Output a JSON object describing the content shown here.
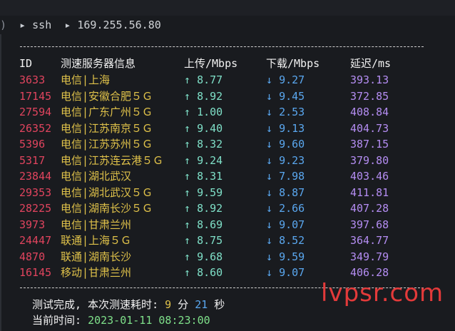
{
  "prompt": {
    "paren": ")",
    "arrow1": "▸",
    "command": "ssh",
    "arrow2": "▸",
    "host": "169.255.56.80"
  },
  "header": {
    "id": "ID",
    "name": "测速服务器信息",
    "upload": "上传/Mbps",
    "download": "下载/Mbps",
    "latency": "延迟/ms"
  },
  "up_arrow": "↑",
  "down_arrow": "↓",
  "rows": [
    {
      "id": "3633",
      "name": "电信|上海",
      "up": "8.77",
      "down": "9.27",
      "latency": "393.13"
    },
    {
      "id": "17145",
      "name": "电信|安徽合肥５Ｇ",
      "up": "8.92",
      "down": "9.45",
      "latency": "372.85"
    },
    {
      "id": "27594",
      "name": "电信|广东广州５Ｇ",
      "up": "1.00",
      "down": "2.53",
      "latency": "408.84"
    },
    {
      "id": "26352",
      "name": "电信|江苏南京５Ｇ",
      "up": "9.40",
      "down": "9.13",
      "latency": "404.73"
    },
    {
      "id": "5396",
      "name": "电信|江苏苏州５Ｇ",
      "up": "8.32",
      "down": "9.60",
      "latency": "387.15"
    },
    {
      "id": "5317",
      "name": "电信|江苏连云港５Ｇ",
      "up": "9.24",
      "down": "9.23",
      "latency": "379.80"
    },
    {
      "id": "23844",
      "name": "电信|湖北武汉",
      "up": "8.31",
      "down": "7.98",
      "latency": "403.46"
    },
    {
      "id": "29353",
      "name": "电信|湖北武汉５Ｇ",
      "up": "9.59",
      "down": "8.87",
      "latency": "411.81"
    },
    {
      "id": "28225",
      "name": "电信|湖南长沙５Ｇ",
      "up": "8.92",
      "down": "2.66",
      "latency": "407.28"
    },
    {
      "id": "3973",
      "name": "电信|甘肃兰州",
      "up": "8.69",
      "down": "9.07",
      "latency": "397.68"
    },
    {
      "id": "24447",
      "name": "联通|上海５Ｇ",
      "up": "8.75",
      "down": "8.52",
      "latency": "364.77"
    },
    {
      "id": "4870",
      "name": "联通|湖南长沙",
      "up": "9.68",
      "down": "9.59",
      "latency": "349.79"
    },
    {
      "id": "16145",
      "name": "移动|甘肃兰州",
      "up": "8.60",
      "down": "9.07",
      "latency": "406.28"
    }
  ],
  "footer": {
    "done_text": "测试完成, 本次测速耗时: ",
    "minutes": "9",
    "min_unit": " 分 ",
    "seconds": "21",
    "sec_unit": " 秒",
    "time_label": "当前时间: ",
    "time_value": "2023-01-11 08:23:00"
  },
  "watermark": "lvpsr.com",
  "colors": {
    "id": "#e0445e",
    "server": "#e0c24a",
    "upload": "#7fe0c8",
    "download": "#5aa7ef",
    "latency": "#b48df2",
    "watermark": "#e33a3a"
  }
}
